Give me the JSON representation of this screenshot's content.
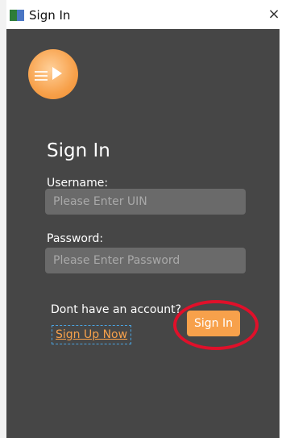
{
  "window": {
    "title": "Sign In",
    "close_symbol": "×",
    "app_icon": "app-window-icon"
  },
  "logo": {
    "icon": "play-logo-icon"
  },
  "form": {
    "heading": "Sign In",
    "username_label": "Username:",
    "username_placeholder": "Please Enter UIN",
    "username_value": "",
    "password_label": "Password:",
    "password_placeholder": "Please Enter Password",
    "password_value": ""
  },
  "footer": {
    "no_account_text": "Dont have an account?",
    "signup_label": "Sign Up Now",
    "signin_label": "Sign In"
  },
  "colors": {
    "background": "#464646",
    "field": "#6a6a6a",
    "accent": "#f7a14b",
    "highlight": "#e0102a",
    "focus_border": "#4aa3e0"
  }
}
